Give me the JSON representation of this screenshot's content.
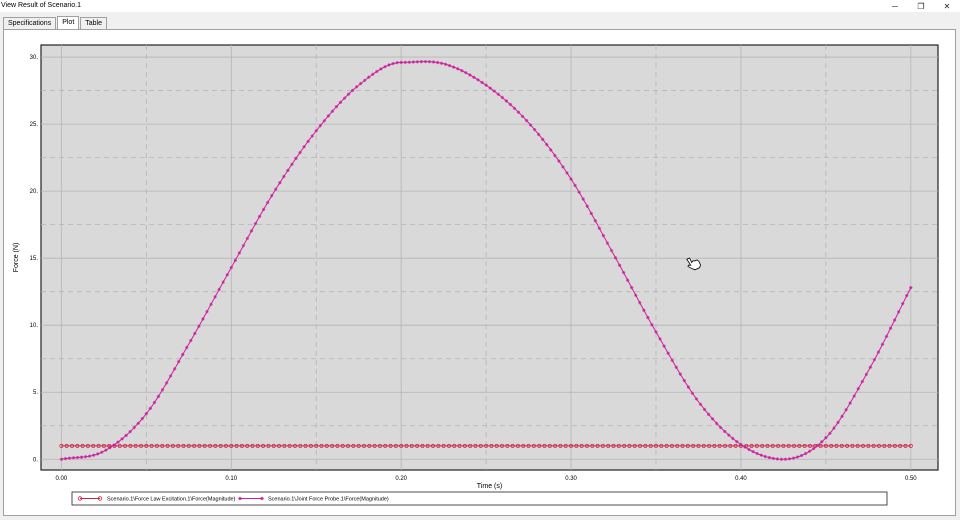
{
  "window": {
    "title": "View Result of Scenario.1",
    "minimize_glyph": "─",
    "restore_glyph": "❐",
    "close_glyph": "✕"
  },
  "tabs": [
    {
      "label": "Specifications",
      "active": false
    },
    {
      "label": "Plot",
      "active": true
    },
    {
      "label": "Table",
      "active": false
    }
  ],
  "chart_data": {
    "type": "line",
    "xlabel": "Time (s)",
    "ylabel": "Force (N)",
    "xlim": [
      -0.012,
      0.516
    ],
    "ylim": [
      -0.8,
      30.9
    ],
    "xticks": [
      0.0,
      0.1,
      0.2,
      0.3,
      0.4,
      0.5
    ],
    "xtick_labels": [
      "0.00",
      "0.10",
      "0.20",
      "0.30",
      "0.40",
      "0.50"
    ],
    "yticks": [
      0,
      5,
      10,
      15,
      20,
      25,
      30
    ],
    "ytick_labels": [
      "0.",
      "5.",
      "10.",
      "15.",
      "20.",
      "25.",
      "30."
    ],
    "grid": true,
    "plot_background": "#d9d9d9",
    "series": [
      {
        "name": "Scenario.1\\Force Law Excitation.1\\Force(Magnitude)",
        "color": "#cc2244",
        "marker": "circle",
        "x": [
          0.0,
          0.5
        ],
        "y": [
          1.0,
          1.0
        ],
        "constant": true
      },
      {
        "name": "Scenario.1\\Joint Force Probe.1\\Force(Magnitude)",
        "color": "#cc1f9b",
        "marker": "star",
        "x": [
          0.0,
          0.025,
          0.05,
          0.075,
          0.1,
          0.125,
          0.15,
          0.175,
          0.2,
          0.225,
          0.25,
          0.275,
          0.3,
          0.325,
          0.35,
          0.375,
          0.4,
          0.425,
          0.45,
          0.475,
          0.5
        ],
        "y": [
          0.0,
          0.6,
          3.4,
          8.6,
          14.3,
          19.9,
          24.5,
          27.9,
          29.6,
          29.5,
          27.9,
          25.1,
          20.9,
          15.3,
          9.5,
          4.3,
          1.1,
          0.0,
          1.6,
          6.6,
          12.8
        ]
      }
    ],
    "legend_position": "bottom"
  },
  "cursor": {
    "icon": "hand-cursor-icon"
  }
}
